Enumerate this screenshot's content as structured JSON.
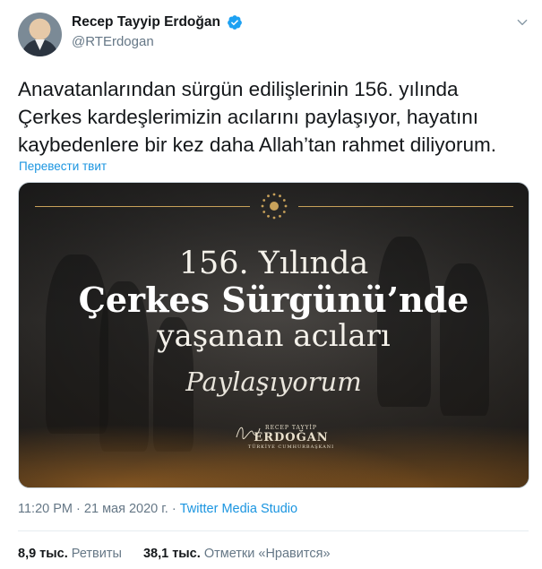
{
  "author": {
    "display_name": "Recep Tayyip Erdoğan",
    "handle": "@RTErdogan",
    "verified": true,
    "verified_color": "#1da1f2"
  },
  "tweet": {
    "text": "Anavatanlarından sürgün edilişlerinin 156. yılında\nÇerkes kardeşlerimizin acılarını paylaşıyor, hayatını\nkaybedenlere bir kez daha Allah’tan rahmet diliyorum.",
    "translate_link": "Перевести твит"
  },
  "media": {
    "line1": "156. Yılında",
    "line2": "Çerkes Sürgünü’nde",
    "line3": "yaşanan acıları",
    "line4": "Paylaşıyorum",
    "signature_small": "RECEP TAYYİP",
    "signature_name": "ERDOĞAN",
    "signature_title": "TÜRKİYE CUMHURBAŞKANI"
  },
  "meta": {
    "time": "11:20 PM",
    "separator": "·",
    "date": "21 мая 2020 г.",
    "source": "Twitter Media Studio"
  },
  "stats": {
    "retweets_count": "8,9 тыс.",
    "retweets_label": "Ретвиты",
    "likes_count": "38,1 тыс.",
    "likes_label": "Отметки «Нравится»"
  },
  "icons": {
    "verified": "verified-badge-icon",
    "more": "chevron-down-icon",
    "emblem": "presidential-seal-icon"
  },
  "colors": {
    "link": "#1b95e0",
    "secondary_text": "#657786",
    "gold": "#c8a15a"
  }
}
